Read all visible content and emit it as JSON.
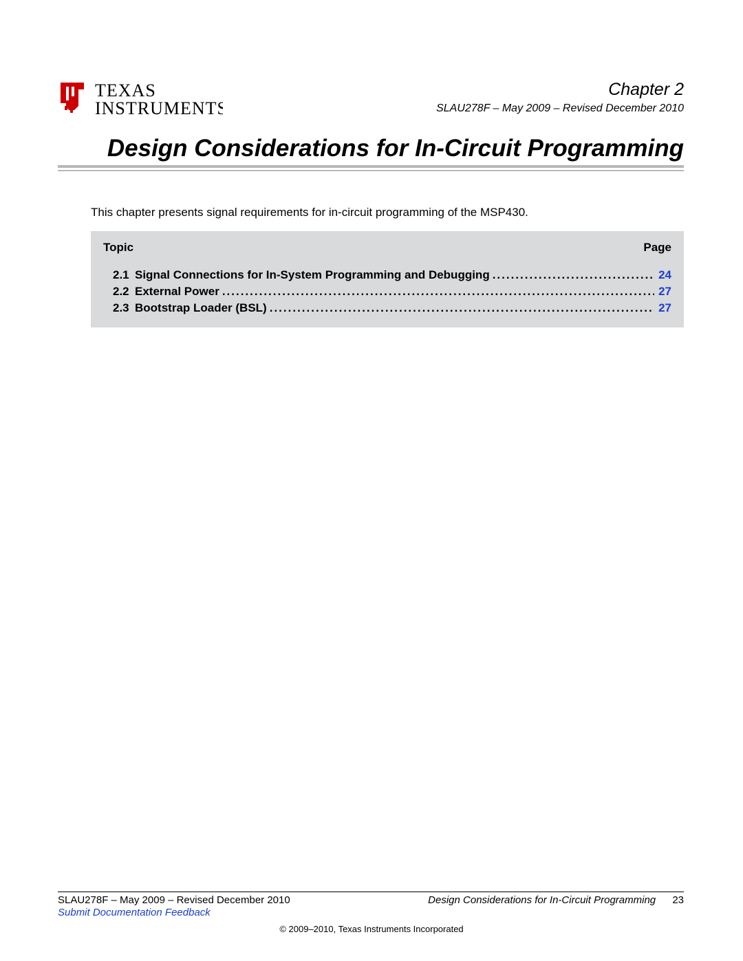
{
  "logo": {
    "brand_top": "TEXAS",
    "brand_bottom": "INSTRUMENTS"
  },
  "header": {
    "chapter_label": "Chapter 2",
    "doc_info": "SLAU278F – May 2009 – Revised December 2010"
  },
  "title": "Design Considerations for In-Circuit Programming",
  "intro": "This chapter presents signal requirements for in-circuit programming of the MSP430.",
  "toc": {
    "topic_header": "Topic",
    "page_header": "Page",
    "dots": ".........................................................................................................................................................................................",
    "items": [
      {
        "num": "2.1",
        "title": "Signal Connections for In-System Programming and Debugging",
        "page": "24"
      },
      {
        "num": "2.2",
        "title": "External Power",
        "page": "27"
      },
      {
        "num": "2.3",
        "title": "Bootstrap Loader (BSL)",
        "page": "27"
      }
    ]
  },
  "footer": {
    "doc_info": "SLAU278F – May 2009 – Revised December 2010",
    "right_title": "Design Considerations for In-Circuit Programming",
    "page_number": "23",
    "feedback": "Submit Documentation Feedback",
    "copyright": "© 2009–2010, Texas Instruments Incorporated"
  }
}
